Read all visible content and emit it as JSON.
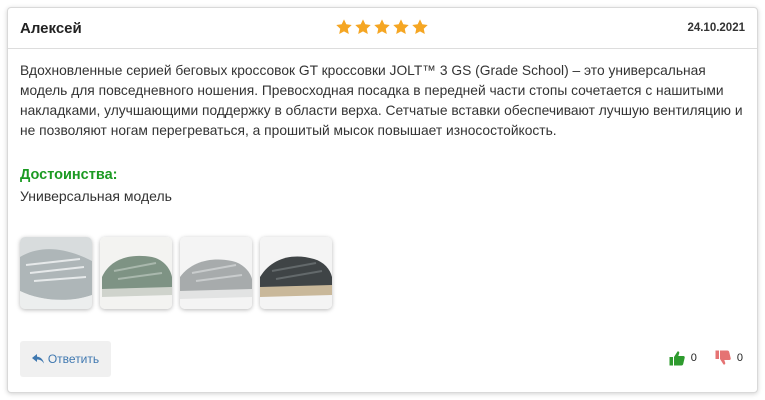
{
  "review": {
    "author": "Алексей",
    "rating": 5,
    "rating_max": 5,
    "date": "24.10.2021",
    "text": "Вдохновленные серией беговых кроссовок GT кроссовки JOLT™ 3 GS (Grade School) – это универсальная модель для повседневного ношения. Превосходная посадка в передней части стопы сочетается с нашитыми накладками, улучшающими поддержку в области верха. Сетчатые вставки обеспечивают лучшую вентиляцию и не позволяют ногам перегреваться, а прошитый мысок повышает износостойкость.",
    "pros_title": "Достоинства:",
    "pros_text": "Универсальная модель",
    "photos": [
      {
        "icon": "photo-grey-sneaker"
      },
      {
        "icon": "photo-green-sneaker"
      },
      {
        "icon": "photo-light-grey-sneaker"
      },
      {
        "icon": "photo-dark-sneaker"
      }
    ]
  },
  "actions": {
    "reply_label": "Ответить",
    "likes": "0",
    "dislikes": "0"
  },
  "colors": {
    "star": "#f5a623",
    "pros_title": "#1b9a22",
    "reply_text": "#3f78b0",
    "like": "#2e9b2e",
    "dislike": "#e57373"
  }
}
